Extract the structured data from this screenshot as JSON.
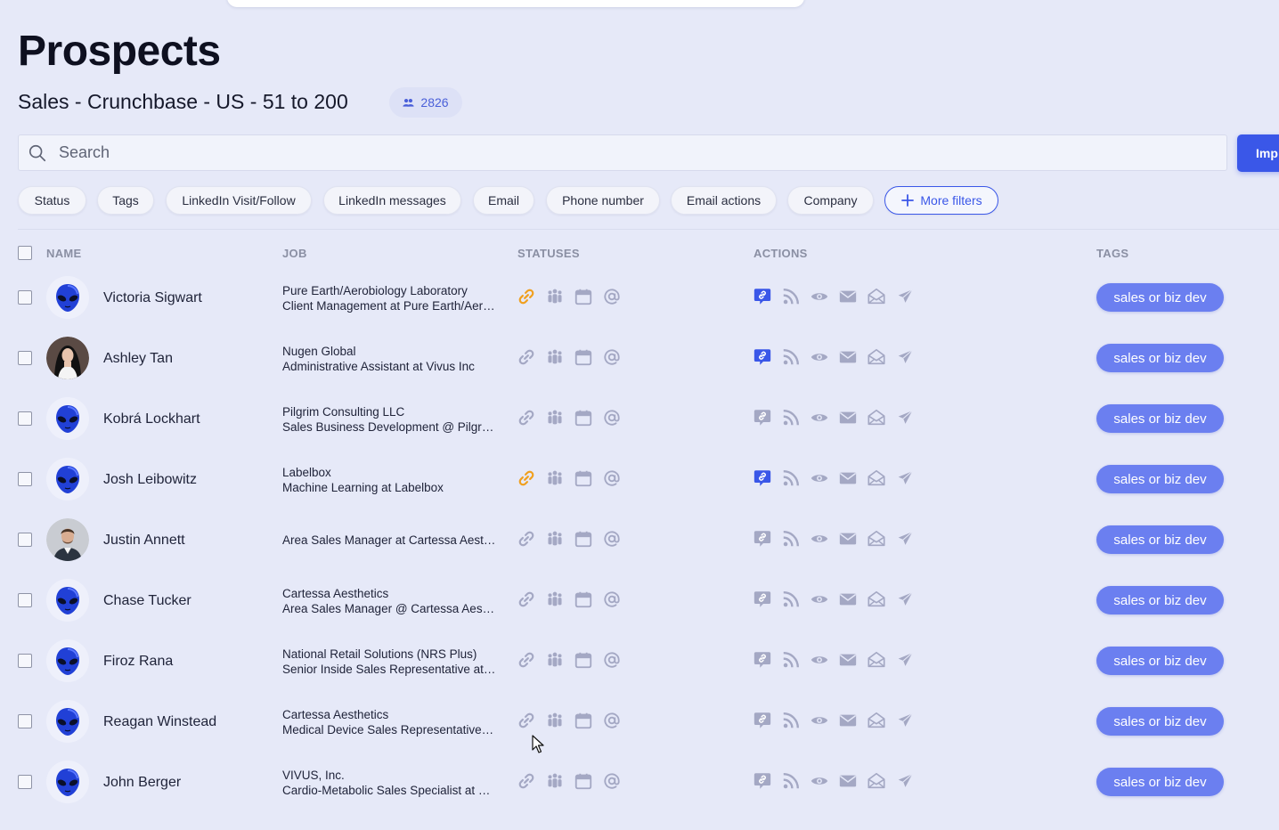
{
  "page": {
    "title": "Prospects"
  },
  "list": {
    "name": "Sales - Crunchbase - US - 51 to 200",
    "count": "2826",
    "count_icon": "people-icon"
  },
  "search": {
    "placeholder": "Search",
    "value": ""
  },
  "import_button": {
    "label": "Imp"
  },
  "filters": [
    {
      "label": "Status"
    },
    {
      "label": "Tags"
    },
    {
      "label": "LinkedIn Visit/Follow"
    },
    {
      "label": "LinkedIn messages"
    },
    {
      "label": "Email"
    },
    {
      "label": "Phone number"
    },
    {
      "label": "Email actions"
    },
    {
      "label": "Company"
    }
  ],
  "more_filters": {
    "label": "More filters"
  },
  "columns": {
    "name": "NAME",
    "job": "JOB",
    "statuses": "STATUSES",
    "actions": "ACTIONS",
    "tags": "TAGS"
  },
  "colors": {
    "accent": "#3a57e8",
    "tag": "#6b7ff0",
    "link_active": "#f0a020",
    "icon_idle": "#a4a8c4",
    "message_active": "#3a57e8"
  },
  "prospects": [
    {
      "name": "Victoria Sigwart",
      "avatar": "alien",
      "job_line1": "Pure Earth/Aerobiology Laboratory",
      "job_line2": "Client Management at Pure Earth/Aerobiology Laboratory",
      "link_active": true,
      "message_active": true,
      "tag": "sales or biz dev"
    },
    {
      "name": "Ashley Tan",
      "avatar": "photo-woman",
      "job_line1": "Nugen Global",
      "job_line2": "Administrative Assistant at Vivus Inc",
      "link_active": false,
      "message_active": true,
      "tag": "sales or biz dev"
    },
    {
      "name": "Kobrá Lockhart",
      "avatar": "alien",
      "job_line1": "Pilgrim Consulting LLC",
      "job_line2": "Sales Business Development @ Pilgrim Consulting LLC",
      "link_active": false,
      "message_active": false,
      "tag": "sales or biz dev"
    },
    {
      "name": "Josh Leibowitz",
      "avatar": "alien",
      "job_line1": "Labelbox",
      "job_line2": "Machine Learning at Labelbox",
      "link_active": true,
      "message_active": true,
      "tag": "sales or biz dev"
    },
    {
      "name": "Justin Annett",
      "avatar": "photo-man",
      "job_line1": "",
      "job_line2": "Area Sales Manager at Cartessa Aesthetics",
      "link_active": false,
      "message_active": false,
      "tag": "sales or biz dev"
    },
    {
      "name": "Chase Tucker",
      "avatar": "alien",
      "job_line1": "Cartessa Aesthetics",
      "job_line2": "Area Sales Manager @ Cartessa Aesthetics",
      "link_active": false,
      "message_active": false,
      "tag": "sales or biz dev"
    },
    {
      "name": "Firoz Rana",
      "avatar": "alien",
      "job_line1": "National Retail Solutions (NRS Plus)",
      "job_line2": "Senior Inside Sales Representative at National Retail Solutions",
      "link_active": false,
      "message_active": false,
      "tag": "sales or biz dev"
    },
    {
      "name": "Reagan Winstead",
      "avatar": "alien",
      "job_line1": "Cartessa Aesthetics",
      "job_line2": "Medical Device Sales Representative at Cartessa Aesthetics",
      "link_active": false,
      "message_active": false,
      "tag": "sales or biz dev"
    },
    {
      "name": "John Berger",
      "avatar": "alien",
      "job_line1": "VIVUS, Inc.",
      "job_line2": "Cardio-Metabolic Sales Specialist at VIVUS, Inc.",
      "link_active": false,
      "message_active": false,
      "tag": "sales or biz dev"
    }
  ]
}
